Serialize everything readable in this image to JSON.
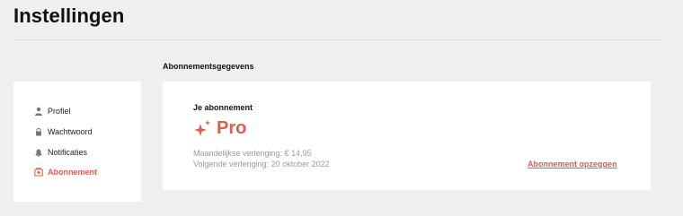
{
  "page": {
    "title": "Instellingen"
  },
  "section": {
    "heading": "Abonnementsgegevens"
  },
  "sidebar": {
    "items": [
      {
        "label": "Profiel",
        "icon": "user-icon",
        "active": false
      },
      {
        "label": "Wachtwoord",
        "icon": "lock-icon",
        "active": false
      },
      {
        "label": "Notificaties",
        "icon": "bell-icon",
        "active": false
      },
      {
        "label": "Abonnement",
        "icon": "subscription-icon",
        "active": true
      }
    ]
  },
  "subscription": {
    "heading": "Je abonnement",
    "plan_name": "Pro",
    "plan_icon": "sparkle-icon",
    "monthly_renewal": "Maandelijkse verlenging: € 14,95",
    "next_renewal": "Volgende verlenging: 20 oktober 2022",
    "cancel_label": "Abonnement opzeggen"
  },
  "colors": {
    "accent": "#d5604f",
    "background": "#efefef",
    "card": "#ffffff",
    "muted_text": "#9a9a9a"
  }
}
